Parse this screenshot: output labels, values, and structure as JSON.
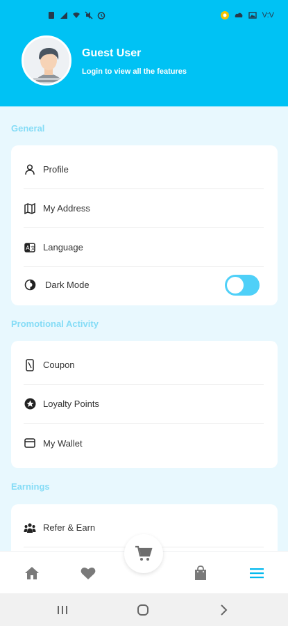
{
  "status_bar": {
    "time": "V:V",
    "left_icons": [
      "sim-icon",
      "signal-icon",
      "wifi-icon",
      "mute-icon",
      "alarm-icon"
    ],
    "right_icons": [
      "notification-dot-icon",
      "cloud-icon",
      "image-icon"
    ]
  },
  "profile": {
    "name": "Guest User",
    "subtitle": "Login to view all the features"
  },
  "sections": {
    "general": {
      "title": "General",
      "items": [
        {
          "label": "Profile",
          "icon": "person-icon"
        },
        {
          "label": "My Address",
          "icon": "map-icon"
        },
        {
          "label": "Language",
          "icon": "language-icon"
        },
        {
          "label": "Dark Mode",
          "icon": "contrast-icon",
          "toggle": true,
          "toggle_on": false
        }
      ]
    },
    "promo": {
      "title": "Promotional Activity",
      "items": [
        {
          "label": "Coupon",
          "icon": "coupon-icon"
        },
        {
          "label": "Loyalty Points",
          "icon": "star-badge-icon"
        },
        {
          "label": "My Wallet",
          "icon": "wallet-icon"
        }
      ]
    },
    "earnings": {
      "title": "Earnings",
      "items": [
        {
          "label": "Refer & Earn",
          "icon": "people-icon"
        }
      ]
    }
  },
  "bottom_nav": {
    "items": [
      "home-icon",
      "heart-icon",
      "cart-icon",
      "bag-icon",
      "menu-icon"
    ],
    "active": "menu-icon",
    "accent": "#00b8ee",
    "inactive": "#7a7a7a"
  },
  "colors": {
    "header": "#00c2f4",
    "background": "#e8f8fe",
    "section_title": "#85dcf6",
    "toggle": "#4fd0f8"
  }
}
